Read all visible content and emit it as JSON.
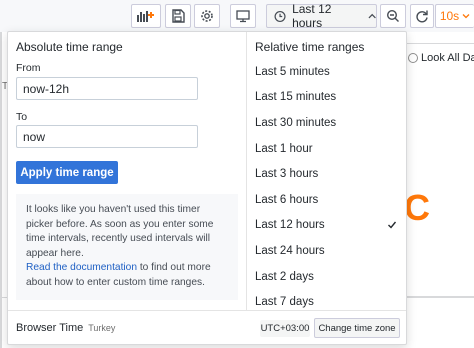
{
  "toolbar": {
    "time_range_label": "Last 12 hours",
    "refresh_interval": "10s"
  },
  "background": {
    "look_all_label": "Look All Data",
    "panel_letter": "C",
    "side_letter": "T"
  },
  "picker": {
    "absolute": {
      "title": "Absolute time range",
      "from_label": "From",
      "from_value": "now-12h",
      "to_label": "To",
      "to_value": "now",
      "apply_label": "Apply time range",
      "info_text_1": "It looks like you haven't used this timer picker before. As soon as you enter some time intervals, recently used intervals will appear here.",
      "info_link": "Read the documentation",
      "info_text_2": " to find out more about how to enter custom time ranges."
    },
    "relative": {
      "title": "Relative time ranges",
      "items": [
        {
          "label": "Last 5 minutes"
        },
        {
          "label": "Last 15 minutes"
        },
        {
          "label": "Last 30 minutes"
        },
        {
          "label": "Last 1 hour"
        },
        {
          "label": "Last 3 hours"
        },
        {
          "label": "Last 6 hours"
        },
        {
          "label": "Last 12 hours"
        },
        {
          "label": "Last 24 hours"
        },
        {
          "label": "Last 2 days"
        },
        {
          "label": "Last 7 days"
        }
      ],
      "selected_index": 6,
      "check_icon": "checkmark-icon"
    },
    "footer": {
      "label": "Browser Time",
      "timezone": "Turkey",
      "offset": "UTC+03:00",
      "change_tz_label": "Change time zone"
    }
  },
  "colors": {
    "accent": "#ff780a",
    "primary_button": "#3274d9",
    "link": "#1f60c4"
  }
}
